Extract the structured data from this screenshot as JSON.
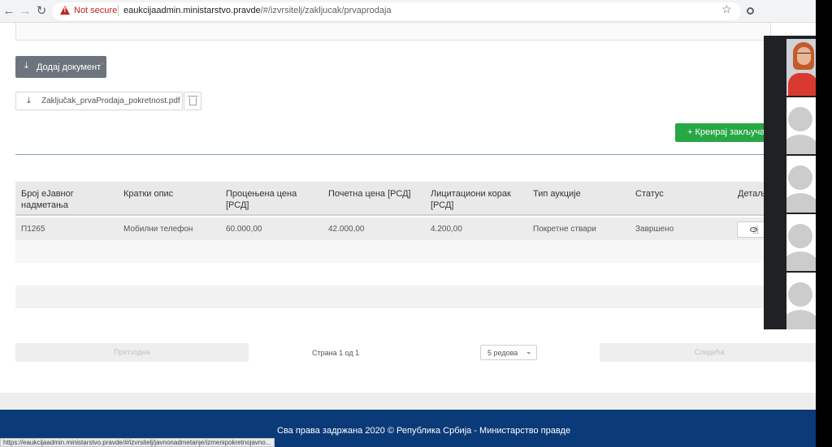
{
  "browser": {
    "security_label": "Not secure",
    "url_host": "eaukcijaadmin.ministarstvo.pravde",
    "url_path": "/#/izvrsitelj/zakljucak/prvaprodaja"
  },
  "documents": {
    "add_label": "Додај документ",
    "required_marker": "*",
    "file_name": "Zaključak_prvaProdaja_pokretnost.pdf"
  },
  "actions": {
    "create_label": "+ Креирај закључак"
  },
  "table": {
    "headers": [
      "Број еЈавног надметања",
      "Кратки опис",
      "Процењена цена [РСД]",
      "Почетна цена [РСД]",
      "Лицитациони корак [РСД]",
      "Тип аукције",
      "Статус",
      "Детаљи"
    ],
    "rows": [
      [
        "П1265",
        "Мобилни телефон",
        "60.000,00",
        "42.000,00",
        "4.200,00",
        "Покретне ствари",
        "Завршено"
      ]
    ]
  },
  "pagination": {
    "prev_label": "Претходна",
    "page_info": "Страна 1 од 1",
    "page_size": "5 редова",
    "next_label": "Следећа"
  },
  "footer": {
    "text": "Сва права задржана 2020 © Република Србија - Министарство правде"
  },
  "status_bar": {
    "link": "https://eaukcijaadmin.ministarstvo.pravde/#/izvrsitelj/javnonadmetanje/izmenipokretnojavno..."
  },
  "colors": {
    "primary_button": "#6c757d",
    "success_button": "#28a745",
    "footer": "#0b3a78"
  }
}
